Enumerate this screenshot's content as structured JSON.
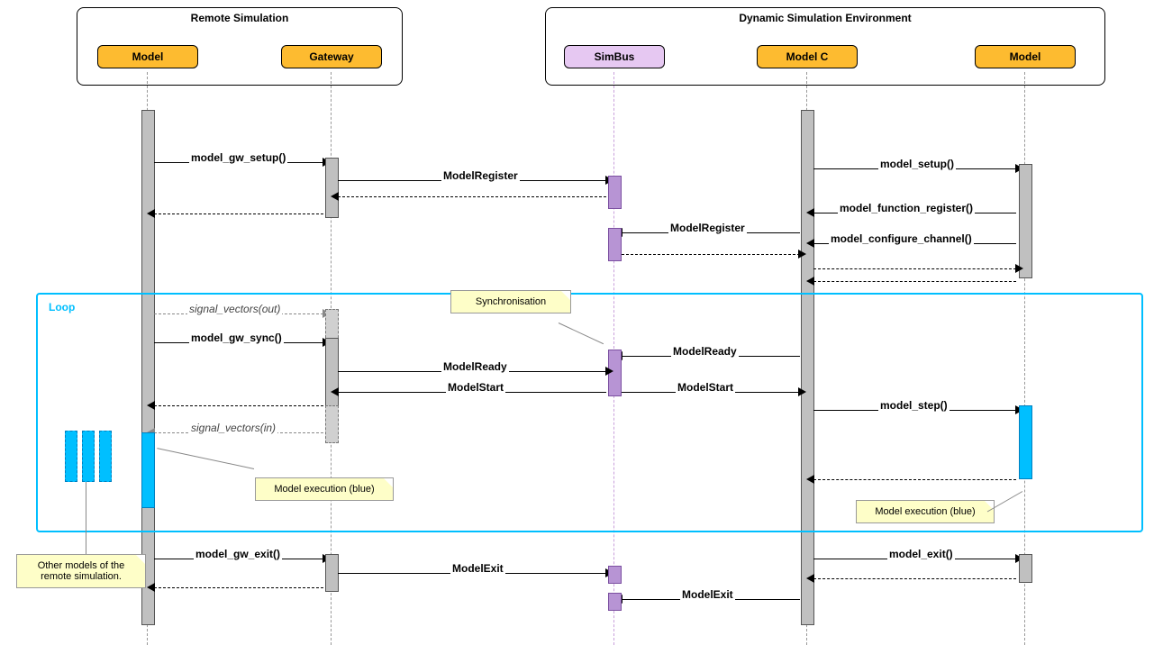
{
  "groups": {
    "remote": "Remote Simulation",
    "dse": "Dynamic Simulation Environment"
  },
  "participants": {
    "model_l": "Model",
    "gateway": "Gateway",
    "simbus": "SimBus",
    "model_c": "Model C",
    "model_r": "Model"
  },
  "loop": "Loop",
  "messages": {
    "gw_setup": "model_gw_setup()",
    "reg1": "ModelRegister",
    "setup": "model_setup()",
    "freg": "model_function_register()",
    "cfgch": "model_configure_channel()",
    "reg2": "ModelRegister",
    "svo": "signal_vectors(out)",
    "sync": "model_gw_sync()",
    "ready1": "ModelReady",
    "ready2": "ModelReady",
    "start1": "ModelStart",
    "start2": "ModelStart",
    "step": "model_step()",
    "svi": "signal_vectors(in)",
    "gwexit": "model_gw_exit()",
    "mexit1": "ModelExit",
    "mexit": "model_exit()",
    "mexit2": "ModelExit"
  },
  "notes": {
    "sync": "Synchronisation",
    "exec": "Model execution (blue)",
    "other": "Other models of the\nremote simulation."
  }
}
